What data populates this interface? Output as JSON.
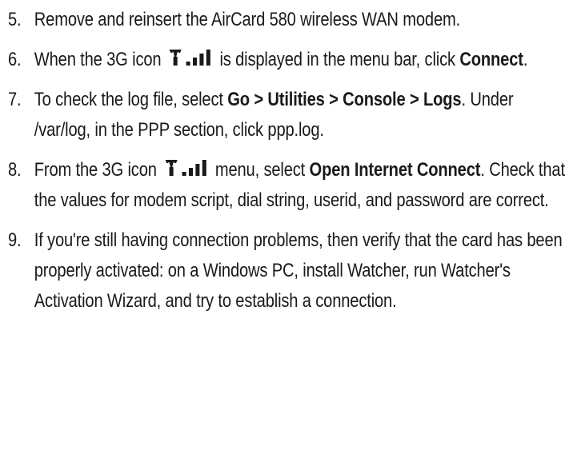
{
  "steps": [
    {
      "number": "5.",
      "text": "Remove and reinsert the AirCard 580 wireless WAN modem."
    },
    {
      "number": "6.",
      "part1": "When the 3G icon",
      "icon": "3g-signal-icon",
      "part2": "is displayed in the menu bar, click",
      "bold1": "Connect",
      "part3": "."
    },
    {
      "number": "7.",
      "part1": "To check the log file, select",
      "bold1": "Go > Utilities > Console > Logs",
      "part2": ". Under /var/log, in the PPP section, click ppp.log."
    },
    {
      "number": "8.",
      "part1": "From the 3G icon",
      "icon": "3g-signal-icon",
      "part2": "menu, select",
      "bold1": "Open Internet Connect",
      "part3": ". Check that the values for modem script, dial string, userid, and password are correct."
    },
    {
      "number": "9.",
      "text": "If you're still having connection problems, then verify that the card has been properly activated: on a Windows PC, install Watcher, run Watcher's Activation Wizard, and try to establish a connection."
    }
  ]
}
